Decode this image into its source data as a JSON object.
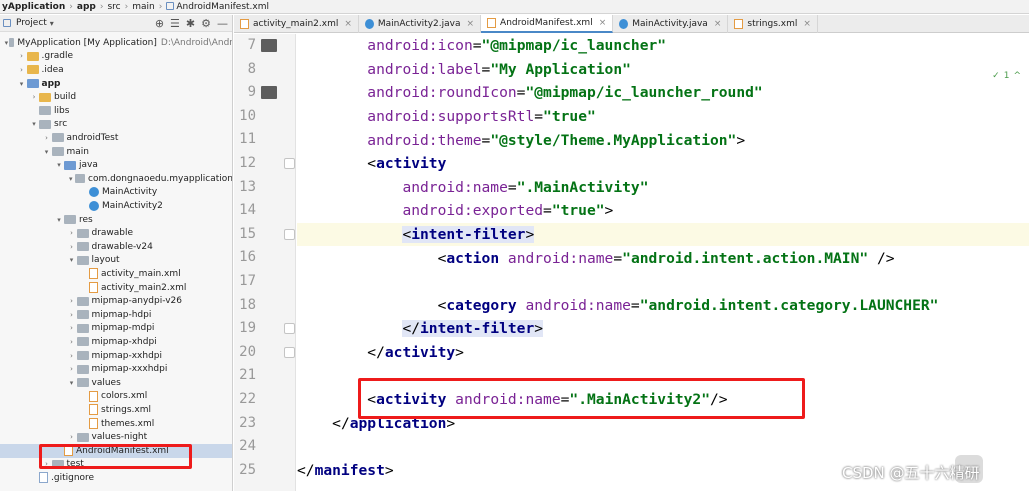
{
  "breadcrumb": {
    "app_name": "yApplication",
    "items": [
      "app",
      "src",
      "main",
      "AndroidManifest.xml"
    ]
  },
  "project_panel": {
    "title": "Project",
    "caret": "▾",
    "tools": [
      "⊕",
      "☰",
      "✱",
      "⚙",
      "—"
    ],
    "tree": [
      {
        "label": "MyApplication [My Application]",
        "hint": "D:\\Android\\Andr",
        "arrow": "▾",
        "icon": "folder gray",
        "indent": 0,
        "bold": false
      },
      {
        "label": ".gradle",
        "arrow": "›",
        "icon": "folder",
        "indent": 1
      },
      {
        "label": ".idea",
        "arrow": "›",
        "icon": "folder",
        "indent": 1
      },
      {
        "label": "app",
        "arrow": "▾",
        "icon": "folder blue",
        "indent": 1,
        "bold": true
      },
      {
        "label": "build",
        "arrow": "›",
        "icon": "folder",
        "indent": 2
      },
      {
        "label": "libs",
        "arrow": "",
        "icon": "folder gray",
        "indent": 2
      },
      {
        "label": "src",
        "arrow": "▾",
        "icon": "folder gray",
        "indent": 2
      },
      {
        "label": "androidTest",
        "arrow": "›",
        "icon": "folder gray",
        "indent": 3
      },
      {
        "label": "main",
        "arrow": "▾",
        "icon": "folder gray",
        "indent": 3
      },
      {
        "label": "java",
        "arrow": "▾",
        "icon": "folder blue",
        "indent": 4
      },
      {
        "label": "com.dongnaoedu.myapplication",
        "arrow": "▾",
        "icon": "folder gray",
        "indent": 5
      },
      {
        "label": "MainActivity",
        "arrow": "",
        "icon": "cls",
        "indent": 6
      },
      {
        "label": "MainActivity2",
        "arrow": "",
        "icon": "cls",
        "indent": 6
      },
      {
        "label": "res",
        "arrow": "▾",
        "icon": "folder gray",
        "indent": 4
      },
      {
        "label": "drawable",
        "arrow": "›",
        "icon": "folder gray",
        "indent": 5
      },
      {
        "label": "drawable-v24",
        "arrow": "›",
        "icon": "folder gray",
        "indent": 5
      },
      {
        "label": "layout",
        "arrow": "▾",
        "icon": "folder gray",
        "indent": 5
      },
      {
        "label": "activity_main.xml",
        "arrow": "",
        "icon": "xml",
        "indent": 6
      },
      {
        "label": "activity_main2.xml",
        "arrow": "",
        "icon": "xml",
        "indent": 6
      },
      {
        "label": "mipmap-anydpi-v26",
        "arrow": "›",
        "icon": "folder gray",
        "indent": 5
      },
      {
        "label": "mipmap-hdpi",
        "arrow": "›",
        "icon": "folder gray",
        "indent": 5
      },
      {
        "label": "mipmap-mdpi",
        "arrow": "›",
        "icon": "folder gray",
        "indent": 5
      },
      {
        "label": "mipmap-xhdpi",
        "arrow": "›",
        "icon": "folder gray",
        "indent": 5
      },
      {
        "label": "mipmap-xxhdpi",
        "arrow": "›",
        "icon": "folder gray",
        "indent": 5
      },
      {
        "label": "mipmap-xxxhdpi",
        "arrow": "›",
        "icon": "folder gray",
        "indent": 5
      },
      {
        "label": "values",
        "arrow": "▾",
        "icon": "folder gray",
        "indent": 5
      },
      {
        "label": "colors.xml",
        "arrow": "",
        "icon": "xml",
        "indent": 6
      },
      {
        "label": "strings.xml",
        "arrow": "",
        "icon": "xml",
        "indent": 6
      },
      {
        "label": "themes.xml",
        "arrow": "",
        "icon": "xml",
        "indent": 6
      },
      {
        "label": "values-night",
        "arrow": "›",
        "icon": "folder gray",
        "indent": 5
      },
      {
        "label": "AndroidManifest.xml",
        "arrow": "",
        "icon": "xml",
        "indent": 4,
        "selected": true
      },
      {
        "label": "test",
        "arrow": "›",
        "icon": "folder gray",
        "indent": 3
      },
      {
        "label": ".gitignore",
        "arrow": "",
        "icon": "file",
        "indent": 2
      }
    ]
  },
  "tabs": [
    {
      "label": "activity_main2.xml",
      "kind": "xml",
      "active": false
    },
    {
      "label": "MainActivity2.java",
      "kind": "java",
      "active": false
    },
    {
      "label": "AndroidManifest.xml",
      "kind": "xml",
      "active": true
    },
    {
      "label": "MainActivity.java",
      "kind": "java",
      "active": false
    },
    {
      "label": "strings.xml",
      "kind": "xml",
      "active": false
    }
  ],
  "tab_close": "×",
  "inspection": {
    "icon": "✓",
    "count": "1",
    "arrow_up": "^"
  },
  "editor": {
    "line_numbers": [
      "7",
      "8",
      "9",
      "10",
      "11",
      "12",
      "13",
      "14",
      "15",
      "16",
      "17",
      "18",
      "19",
      "20",
      "21",
      "22",
      "23",
      "24",
      "25"
    ],
    "lines": [
      [
        {
          "t": "        "
        },
        {
          "t": "android:",
          "c": "attr"
        },
        {
          "t": "icon",
          "c": "attr"
        },
        {
          "t": "=",
          "c": ""
        },
        {
          "t": "\"@mipmap/ic_launcher\"",
          "c": "str"
        }
      ],
      [
        {
          "t": "        "
        },
        {
          "t": "android:",
          "c": "attr"
        },
        {
          "t": "label",
          "c": "attr"
        },
        {
          "t": "=",
          "c": ""
        },
        {
          "t": "\"My Application\"",
          "c": "str"
        }
      ],
      [
        {
          "t": "        "
        },
        {
          "t": "android:",
          "c": "attr"
        },
        {
          "t": "roundIcon",
          "c": "attr"
        },
        {
          "t": "=",
          "c": ""
        },
        {
          "t": "\"@mipmap/ic_launcher_round\"",
          "c": "str"
        }
      ],
      [
        {
          "t": "        "
        },
        {
          "t": "android:",
          "c": "attr"
        },
        {
          "t": "supportsRtl",
          "c": "attr"
        },
        {
          "t": "=",
          "c": ""
        },
        {
          "t": "\"true\"",
          "c": "str"
        }
      ],
      [
        {
          "t": "        "
        },
        {
          "t": "android:",
          "c": "attr"
        },
        {
          "t": "theme",
          "c": "attr"
        },
        {
          "t": "=",
          "c": ""
        },
        {
          "t": "\"@style/Theme.MyApplication\"",
          "c": "str"
        },
        {
          "t": ">",
          "c": ""
        }
      ],
      [
        {
          "t": "        "
        },
        {
          "t": "<",
          "c": ""
        },
        {
          "t": "activity",
          "c": "tag"
        }
      ],
      [
        {
          "t": "            "
        },
        {
          "t": "android:",
          "c": "attr"
        },
        {
          "t": "name",
          "c": "attr"
        },
        {
          "t": "=",
          "c": ""
        },
        {
          "t": "\".MainActivity\"",
          "c": "str"
        }
      ],
      [
        {
          "t": "            "
        },
        {
          "t": "android:",
          "c": "attr"
        },
        {
          "t": "exported",
          "c": "attr"
        },
        {
          "t": "=",
          "c": ""
        },
        {
          "t": "\"true\"",
          "c": "str"
        },
        {
          "t": ">",
          "c": ""
        }
      ],
      [
        {
          "t": "            "
        },
        {
          "t": "<",
          "c": "sel"
        },
        {
          "t": "intent-filter",
          "c": "tag sel"
        },
        {
          "t": ">",
          "c": "sel"
        }
      ],
      [
        {
          "t": "                "
        },
        {
          "t": "<",
          "c": ""
        },
        {
          "t": "action ",
          "c": "tag"
        },
        {
          "t": "android:",
          "c": "attr"
        },
        {
          "t": "name",
          "c": "attr"
        },
        {
          "t": "=",
          "c": ""
        },
        {
          "t": "\"android.intent.action.MAIN\"",
          "c": "str"
        },
        {
          "t": " />",
          "c": ""
        }
      ],
      [
        {
          "t": ""
        }
      ],
      [
        {
          "t": "                "
        },
        {
          "t": "<",
          "c": ""
        },
        {
          "t": "category ",
          "c": "tag"
        },
        {
          "t": "android:",
          "c": "attr"
        },
        {
          "t": "name",
          "c": "attr"
        },
        {
          "t": "=",
          "c": ""
        },
        {
          "t": "\"android.intent.category.LAUNCHER\"",
          "c": "str"
        }
      ],
      [
        {
          "t": "            "
        },
        {
          "t": "</",
          "c": "sel"
        },
        {
          "t": "intent-filter",
          "c": "tag sel"
        },
        {
          "t": ">",
          "c": "sel"
        }
      ],
      [
        {
          "t": "        "
        },
        {
          "t": "</",
          "c": ""
        },
        {
          "t": "activity",
          "c": "tag"
        },
        {
          "t": ">",
          "c": ""
        }
      ],
      [
        {
          "t": ""
        }
      ],
      [
        {
          "t": "        "
        },
        {
          "t": "<",
          "c": ""
        },
        {
          "t": "activity ",
          "c": "tag"
        },
        {
          "t": "android:",
          "c": "attr"
        },
        {
          "t": "name",
          "c": "attr"
        },
        {
          "t": "=",
          "c": ""
        },
        {
          "t": "\".MainActivity2\"",
          "c": "str"
        },
        {
          "t": "/>",
          "c": ""
        }
      ],
      [
        {
          "t": "    "
        },
        {
          "t": "</",
          "c": ""
        },
        {
          "t": "application",
          "c": "tag"
        },
        {
          "t": ">",
          "c": ""
        }
      ],
      [
        {
          "t": ""
        }
      ],
      [
        {
          "t": "</",
          "c": ""
        },
        {
          "t": "manifest",
          "c": "tag"
        },
        {
          "t": ">",
          "c": ""
        }
      ]
    ],
    "highlighted_line": "15"
  },
  "watermark": "CSDN @五十六精研",
  "colors": {
    "highlight_box": "#ee1b1b",
    "selection": "#c9d7ea"
  }
}
